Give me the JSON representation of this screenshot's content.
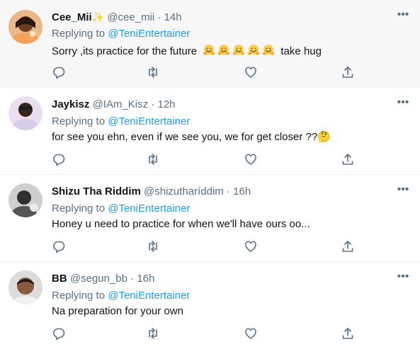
{
  "replying_prefix": "Replying to",
  "more_glyph": "•••",
  "tweets": [
    {
      "name": "Cee_Mii",
      "name_badge": "✨",
      "handle": "@cee_mii",
      "dot": "·",
      "time": "14h",
      "mention": "@TeniEntertainer",
      "text_before": "Sorry ,its practice for the future",
      "hug_count": 5,
      "text_after": "take hug"
    },
    {
      "name": "Jaykisz",
      "handle": "@IAm_Kisz",
      "dot": "·",
      "time": "12h",
      "mention": "@TeniEntertainer",
      "text": "for see you ehn, even if we see you, we for get closer ??🤔"
    },
    {
      "name": "Shizu Tha Riddim",
      "handle": "@shizutharíddim",
      "dot": "·",
      "time": "16h",
      "mention": "@TeniEntertainer",
      "text": "Honey u need to practice for when we'll have ours oo..."
    },
    {
      "name": "BB",
      "handle": "@segun_bb",
      "dot": "·",
      "time": "16h",
      "mention": "@TeniEntertainer",
      "text": "Na preparation for your own"
    }
  ],
  "icons": {
    "reply": "reply-icon",
    "retweet": "retweet-icon",
    "like": "like-icon",
    "share": "share-icon",
    "more": "more-icon",
    "hug": "hugging-face-emoji"
  },
  "colors": {
    "text": "#0f1419",
    "secondary": "#5b7083",
    "link": "#1d9bf0",
    "highlight_bg": "#f7f7f7",
    "divider": "#eff3f4"
  }
}
